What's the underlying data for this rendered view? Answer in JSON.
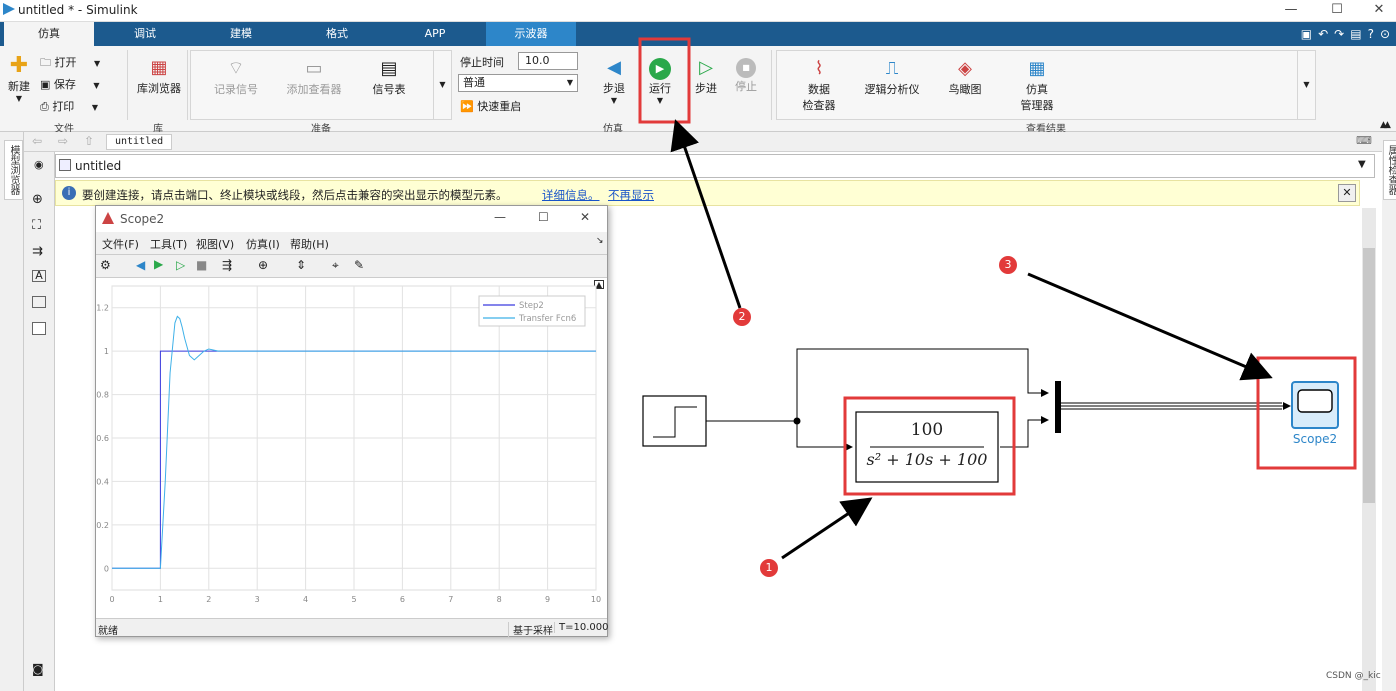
{
  "window": {
    "title": "untitled * - Simulink",
    "minimize": "—",
    "maximize": "☐",
    "close": "✕"
  },
  "tabs": [
    "仿真",
    "调试",
    "建模",
    "格式",
    "APP",
    "示波器"
  ],
  "ribbon": {
    "file": {
      "new": "新建",
      "open": "打开",
      "save": "保存",
      "print": "打印",
      "group": "文件"
    },
    "library": {
      "browser": "库浏览器",
      "group": "库"
    },
    "prepare": {
      "log_signals": "记录信号",
      "add_viewer": "添加查看器",
      "signal_table": "信号表",
      "group": "准备"
    },
    "simulate": {
      "stop_time_label": "停止时间",
      "stop_time_value": "10.0",
      "mode": "普通",
      "fast_restart": "快速重启",
      "step_back": "步退",
      "run": "运行",
      "step_forward": "步进",
      "stop": "停止",
      "group": "仿真"
    },
    "results": {
      "data_inspector": [
        "数据",
        "检查器"
      ],
      "logic_analyzer": "逻辑分析仪",
      "birds_eye": "鸟瞰图",
      "sim_manager": [
        "仿真",
        "管理器"
      ],
      "group": "查看结果"
    }
  },
  "breadcrumb": "untitled",
  "address": "untitled",
  "left_panel_label": "模型浏览器",
  "right_panel_label": "属性检查器",
  "info": {
    "text": "要创建连接，请点击端口、终止模块或线段，然后点击兼容的突出显示的模型元素。",
    "link1": "详细信息。",
    "link2": "不再显示"
  },
  "scope": {
    "title": "Scope2",
    "menus": [
      "文件(F)",
      "工具(T)",
      "视图(V)",
      "仿真(I)",
      "帮助(H)"
    ],
    "status_left": "就绪",
    "status_mid": "基于采样",
    "status_right": "T=10.000"
  },
  "chart_data": {
    "type": "line",
    "title": "",
    "xlabel": "",
    "ylabel": "",
    "xlim": [
      0,
      10
    ],
    "ylim": [
      -0.1,
      1.3
    ],
    "x_ticks": [
      "0",
      "1",
      "2",
      "3",
      "4",
      "5",
      "6",
      "7",
      "8",
      "9",
      "10"
    ],
    "y_ticks": [
      "0",
      "0.2",
      "0.4",
      "0.6",
      "0.8",
      "1",
      "1.2"
    ],
    "legend_position": "top-right",
    "grid": true,
    "series": [
      {
        "name": "Step2",
        "color": "#3a3adf",
        "x": [
          0,
          1,
          1,
          10
        ],
        "y": [
          0,
          0,
          1,
          1
        ]
      },
      {
        "name": "Transfer Fcn6",
        "color": "#3fb1e8",
        "x": [
          0,
          1,
          1.1,
          1.2,
          1.3,
          1.35,
          1.4,
          1.45,
          1.5,
          1.6,
          1.7,
          1.8,
          1.9,
          2.0,
          2.2,
          2.5,
          10
        ],
        "y": [
          0,
          0,
          0.4,
          0.9,
          1.13,
          1.16,
          1.15,
          1.11,
          1.06,
          0.98,
          0.96,
          0.98,
          1.0,
          1.01,
          1.0,
          1.0,
          1.0
        ]
      }
    ]
  },
  "diagram": {
    "tf_numerator": "100",
    "tf_denominator": "s² + 10s + 100",
    "scope_label": "Scope2",
    "badges": [
      "1",
      "2",
      "3"
    ]
  },
  "watermark": "CSDN @_kic",
  "colors": {
    "tab_bar": "#1c5a8e",
    "highlight": "#e23a3a",
    "scope_block": "#2d86c9"
  }
}
